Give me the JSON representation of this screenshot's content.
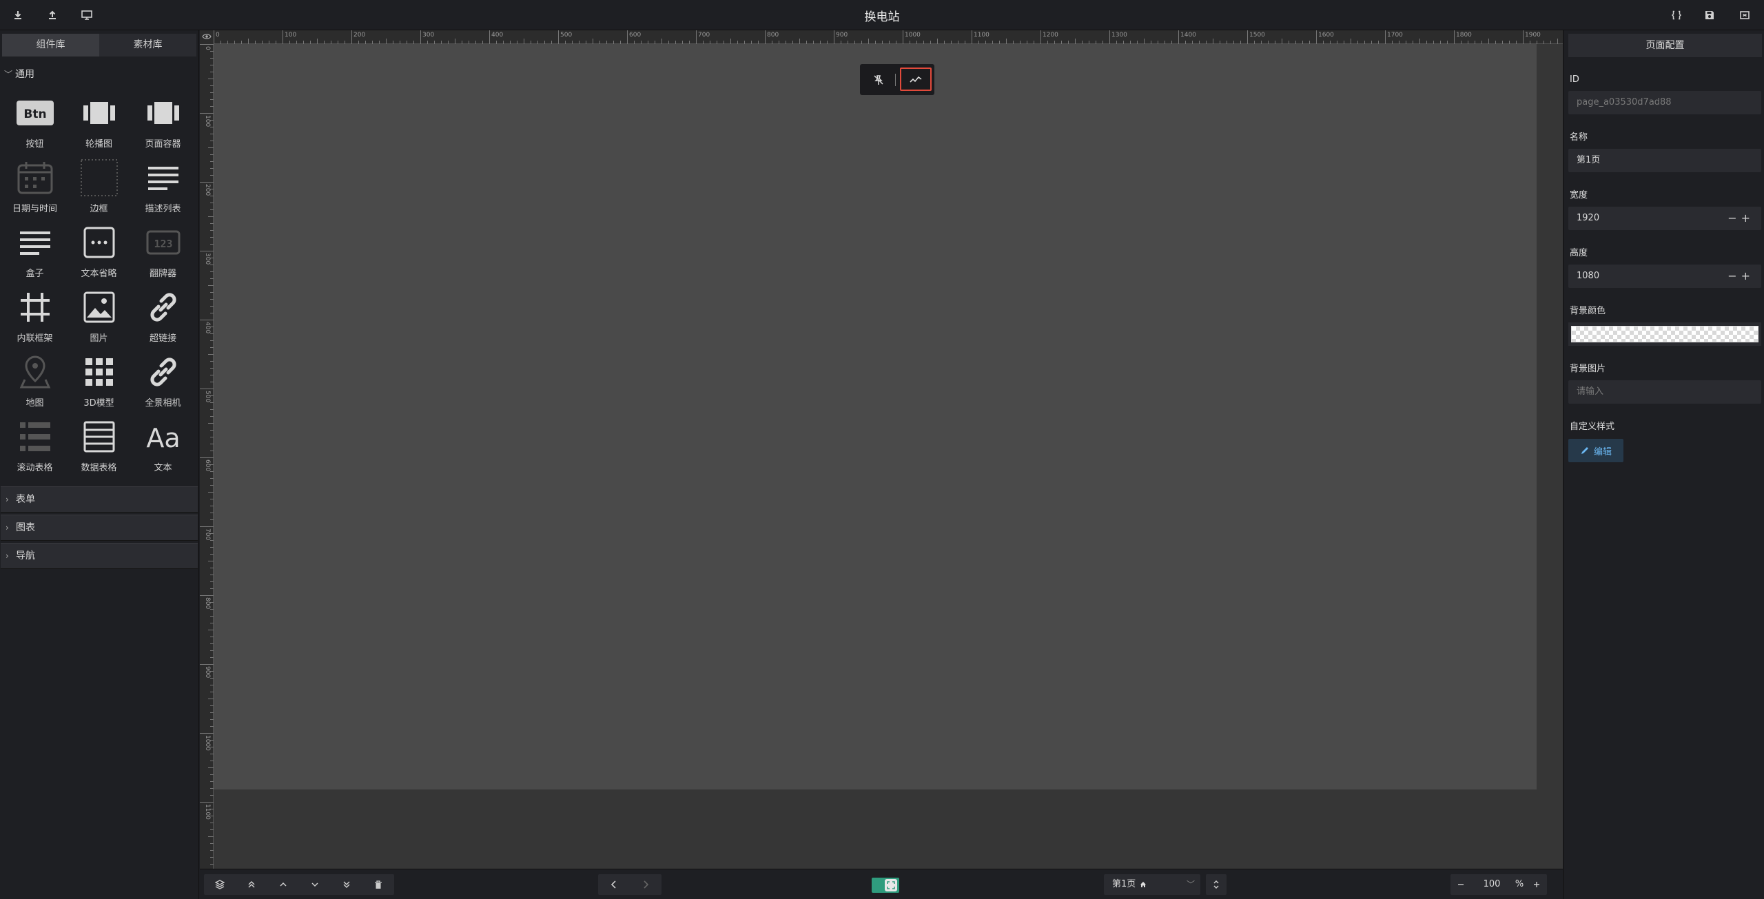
{
  "app": {
    "title": "换电站"
  },
  "topbar": {
    "left_icons": [
      "download-icon",
      "upload-icon",
      "monitor-icon"
    ],
    "right_icons": [
      "code-braces-icon",
      "save-icon",
      "exit-icon"
    ]
  },
  "left_panel": {
    "tabs": [
      {
        "label": "组件库"
      },
      {
        "label": "素材库"
      }
    ],
    "sections": [
      {
        "title": "通用",
        "expanded": true,
        "items": [
          {
            "label": "按钮",
            "icon": "btn-icon"
          },
          {
            "label": "轮播图",
            "icon": "carousel-icon"
          },
          {
            "label": "页面容器",
            "icon": "page-container-icon"
          },
          {
            "label": "日期与时间",
            "icon": "calendar-icon"
          },
          {
            "label": "边框",
            "icon": "border-icon"
          },
          {
            "label": "描述列表",
            "icon": "description-list-icon"
          },
          {
            "label": "盒子",
            "icon": "box-icon"
          },
          {
            "label": "文本省略",
            "icon": "text-ellipsis-icon"
          },
          {
            "label": "翻牌器",
            "icon": "flip-counter-icon"
          },
          {
            "label": "内联框架",
            "icon": "iframe-icon"
          },
          {
            "label": "图片",
            "icon": "image-icon"
          },
          {
            "label": "超链接",
            "icon": "link-icon"
          },
          {
            "label": "地图",
            "icon": "map-pin-icon"
          },
          {
            "label": "3D模型",
            "icon": "grid-3d-icon"
          },
          {
            "label": "全景相机",
            "icon": "panorama-link-icon"
          },
          {
            "label": "滚动表格",
            "icon": "scroll-table-icon"
          },
          {
            "label": "数据表格",
            "icon": "data-table-icon"
          },
          {
            "label": "文本",
            "icon": "text-aa-icon"
          }
        ]
      },
      {
        "title": "表单",
        "expanded": false
      },
      {
        "title": "图表",
        "expanded": false
      },
      {
        "title": "导航",
        "expanded": false
      }
    ]
  },
  "canvas": {
    "ruler_top_labels": [
      "0",
      "100",
      "200",
      "300",
      "400",
      "500",
      "600",
      "700",
      "800",
      "900",
      "1000",
      "1100",
      "1200",
      "1300",
      "1400",
      "1500",
      "1600",
      "1700",
      "1800",
      "1900"
    ],
    "ruler_left_labels": [
      "0",
      "100",
      "200",
      "300",
      "400",
      "500",
      "600",
      "700",
      "800",
      "900",
      "1000",
      "1100"
    ],
    "float_toolbar": {
      "buttons": [
        "pin-off-icon",
        "trend-line-icon"
      ],
      "active_index": 1
    }
  },
  "bottombar": {
    "layer_buttons": [
      "layers-icon",
      "bring-to-front-icon",
      "bring-forward-icon",
      "send-backward-icon",
      "send-to-back-icon",
      "delete-icon"
    ],
    "nav_buttons": [
      "prev-icon",
      "next-icon"
    ],
    "toggle_color": "#2f9c7e",
    "page_select": {
      "value": "第1页",
      "home_icon": "home-icon"
    },
    "zoom": {
      "value": "100",
      "unit": "%"
    }
  },
  "right_panel": {
    "header": "页面配置",
    "fields": {
      "id": {
        "label": "ID",
        "value": "page_a03530d7ad88"
      },
      "name": {
        "label": "名称",
        "value": "第1页"
      },
      "width": {
        "label": "宽度",
        "value": "1920"
      },
      "height": {
        "label": "高度",
        "value": "1080"
      },
      "bg_color": {
        "label": "背景颜色"
      },
      "bg_image": {
        "label": "背景图片",
        "placeholder": "请输入"
      },
      "custom_style": {
        "label": "自定义样式",
        "button": "编辑"
      }
    }
  },
  "colors": {
    "canvas_bg": "#4a4a4a",
    "workspace_bg": "#363636",
    "panel_bg": "#1e1f23",
    "highlight_border": "#e24a3b",
    "edit_button_text": "#6ab6f0"
  }
}
